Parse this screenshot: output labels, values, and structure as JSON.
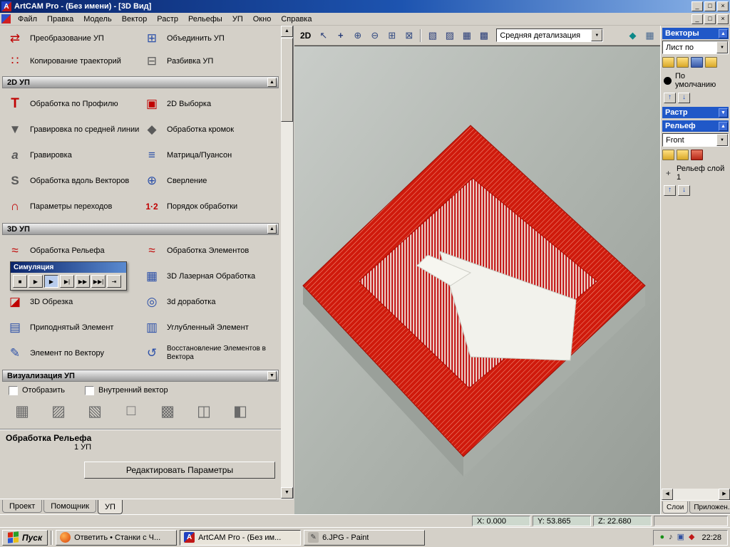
{
  "glyphs": {
    "up": "▲",
    "down": "▼",
    "left": "◀",
    "right": "▶",
    "plus": "+"
  },
  "titlebar": {
    "icon_letter": "A",
    "title": "ArtCAM Pro - (Без имени) - [3D Вид]",
    "buttons": {
      "minimize": "_",
      "restore": "□",
      "close": "×"
    }
  },
  "menubar": {
    "items": [
      "Файл",
      "Правка",
      "Модель",
      "Вектор",
      "Растр",
      "Рельефы",
      "УП",
      "Окно",
      "Справка"
    ],
    "child_buttons": {
      "minimize": "_",
      "restore": "□",
      "close": "×"
    }
  },
  "toolpath_panel": {
    "top_items": [
      {
        "label": "Преобразование УП",
        "glyph": "⇄"
      },
      {
        "label": "Объединить УП",
        "glyph": "⊞"
      },
      {
        "label": "Копирование траекторий",
        "glyph": "∷"
      },
      {
        "label": "Разбивка УП",
        "glyph": "⊟"
      }
    ],
    "section_2d": {
      "title": "2D УП",
      "items": [
        {
          "label": "Обработка по Профилю",
          "glyph": "T"
        },
        {
          "label": "2D Выборка",
          "glyph": "▣"
        },
        {
          "label": "Гравировка по средней линии",
          "glyph": "▼"
        },
        {
          "label": "Обработка кромок",
          "glyph": "◆"
        },
        {
          "label": "Гравировка",
          "glyph": "a"
        },
        {
          "label": "Матрица/Пуансон",
          "glyph": "≡"
        },
        {
          "label": "Обработка вдоль Векторов",
          "glyph": "S"
        },
        {
          "label": "Сверление",
          "glyph": "⊕"
        },
        {
          "label": "Параметры переходов",
          "glyph": "∩"
        },
        {
          "label": "Порядок обработки",
          "glyph": "1·2"
        }
      ]
    },
    "section_3d": {
      "title": "3D УП",
      "items": [
        {
          "label": "Обработка Рельефа",
          "glyph": "≈"
        },
        {
          "label": "Обработка Элементов",
          "glyph": "≈"
        },
        {
          "label": "3D Лазерная Обработка",
          "glyph": "▦"
        },
        {
          "label": "3D Обрезка",
          "glyph": "◪"
        },
        {
          "label": "3d доработка",
          "glyph": "◎"
        },
        {
          "label": "Приподнятый Элемент",
          "glyph": "▤"
        },
        {
          "label": "Углубленный Элемент",
          "glyph": "▥"
        },
        {
          "label": "Элемент по Вектору",
          "glyph": "✎"
        },
        {
          "label": "Восстановление Элементов в Вектора",
          "glyph": "↺"
        }
      ]
    },
    "simulation": {
      "title": "Симуляция",
      "buttons": [
        "■",
        "▶",
        "▶",
        "▶|",
        "▶▶",
        "▶▶|",
        "⇥"
      ]
    },
    "section_vis": {
      "title": "Визуализация УП",
      "checkbox_display": "Отобразить",
      "checkbox_inner": "Внутренний вектор",
      "icons": [
        "▦",
        "▨",
        "▧",
        "□",
        "▩",
        "◫",
        "◧"
      ]
    },
    "footer": {
      "title": "Обработка Рельефа",
      "count": "1 УП",
      "edit_button": "Редактировать Параметры"
    },
    "tabs": [
      "Проект",
      "Помощник",
      "УП"
    ]
  },
  "viewport": {
    "btn_2d": "2D",
    "tools": [
      "↖",
      "+",
      "⊕",
      "⊖",
      "⊞",
      "⊠"
    ],
    "views": [
      "▧",
      "▨",
      "▦",
      "▩"
    ],
    "detail_combo": "Средняя детализация",
    "right_tools": [
      "◆",
      "▦"
    ]
  },
  "right_panel": {
    "vectors": {
      "title": "Векторы",
      "arrow": "▲",
      "combo": "Лист по",
      "item": "По умолчанию"
    },
    "raster": {
      "title": "Растр",
      "arrow": "▼"
    },
    "relief": {
      "title": "Рельеф",
      "arrow": "▲",
      "combo": "Front",
      "item": "Рельеф слой 1"
    },
    "up_arrow": "↑",
    "down_arrow": "↓",
    "tabs": [
      "Слои",
      "Приложен."
    ]
  },
  "statusbar": {
    "x": "X: 0.000",
    "y": "Y: 53.865",
    "z": "Z: 22.680"
  },
  "taskbar": {
    "start": "Пуск",
    "tasks": [
      "Ответить • Станки с Ч...",
      "ArtCAM Pro - (Без им...",
      "6.JPG - Paint"
    ],
    "tray_icons": [
      "●",
      "♪",
      "▣",
      "◆"
    ],
    "clock": "22:28"
  }
}
